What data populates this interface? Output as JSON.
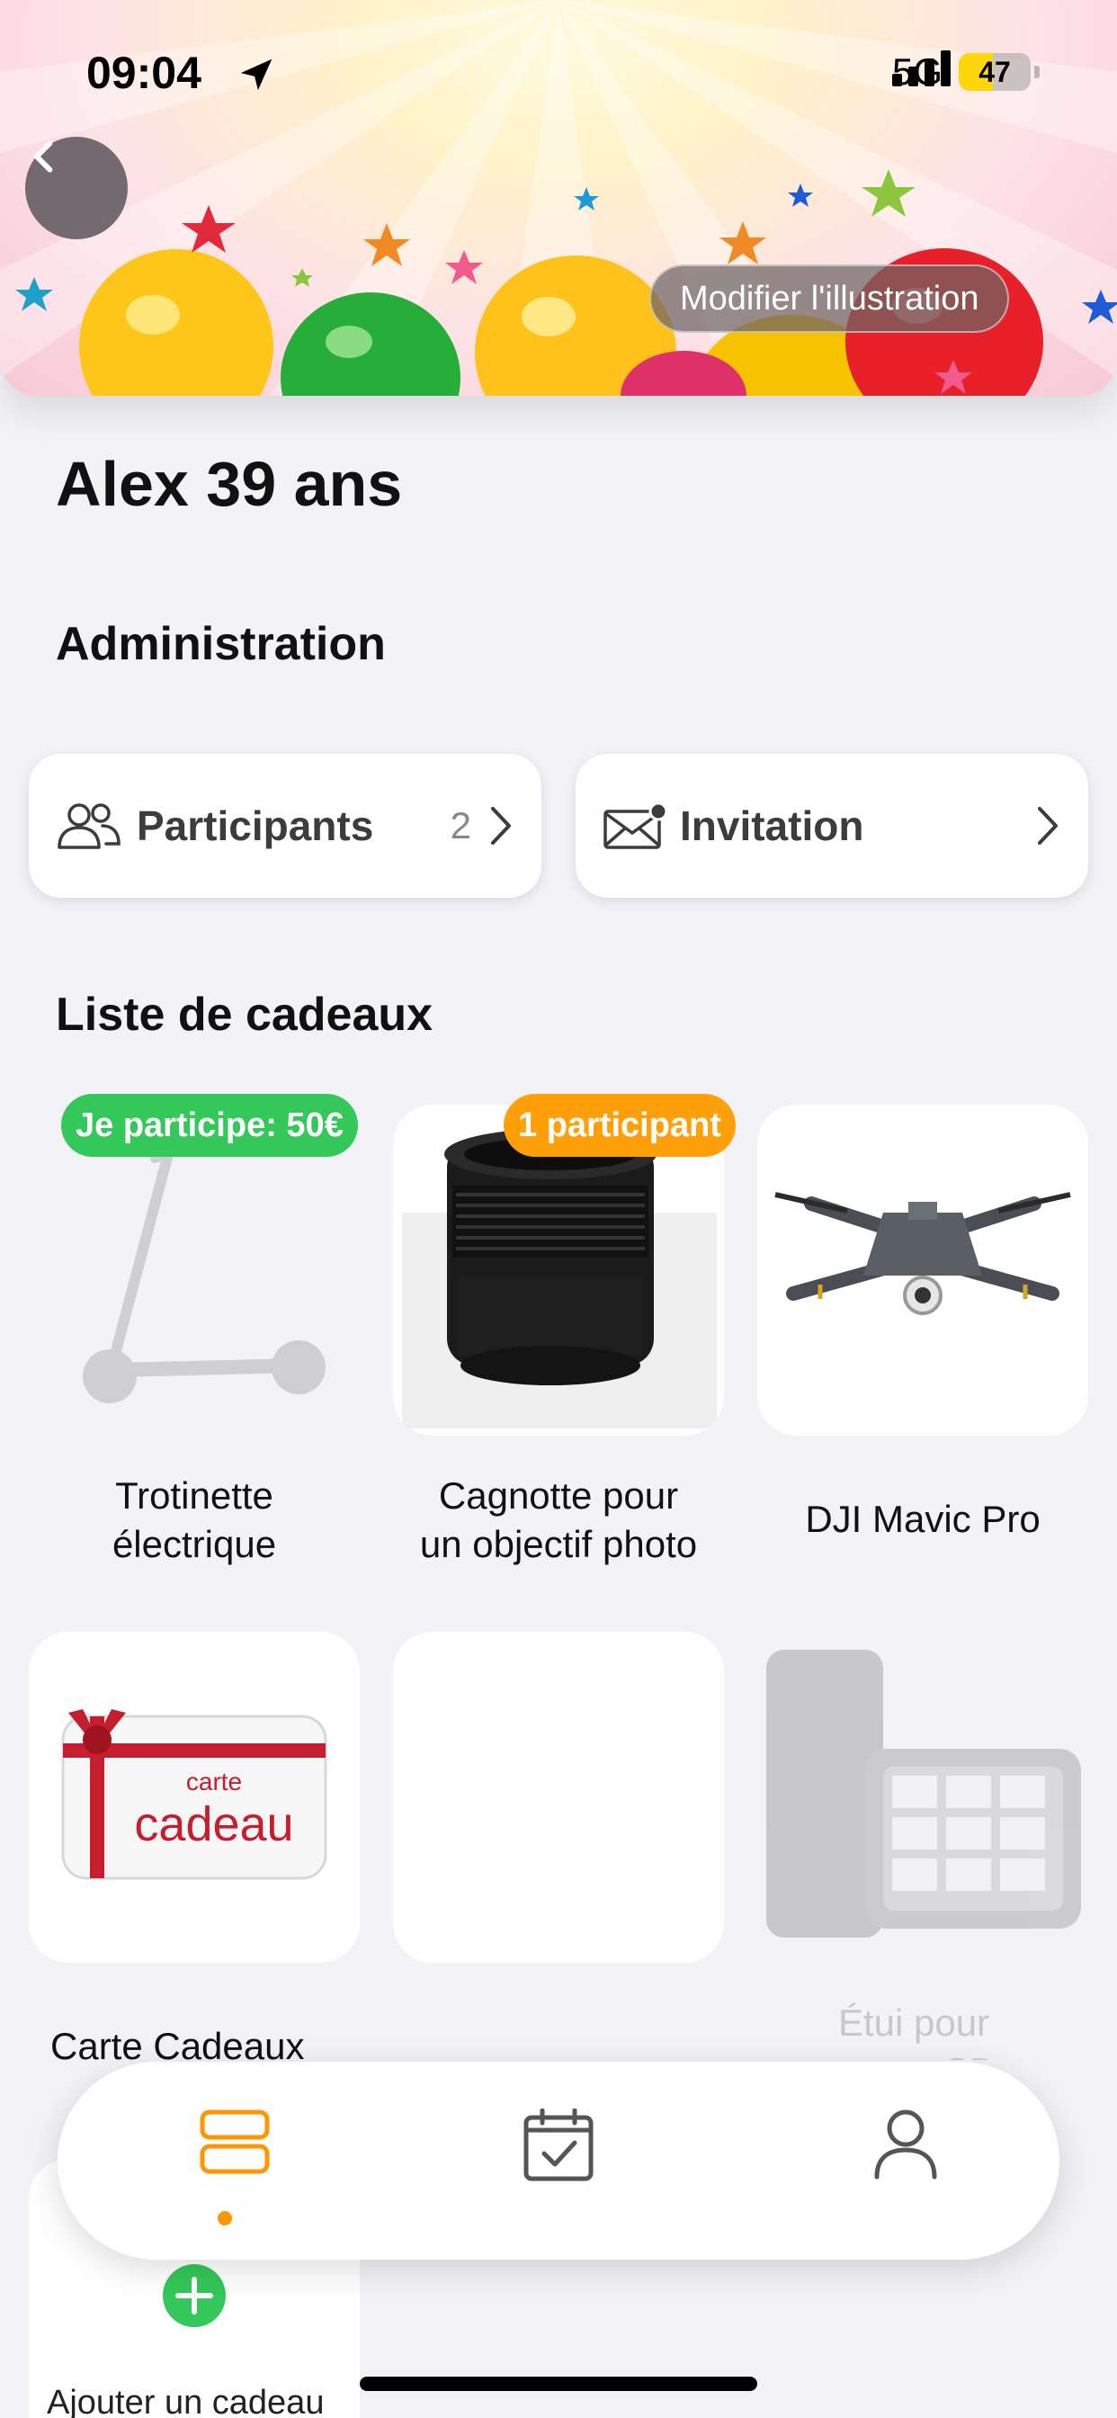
{
  "status_bar": {
    "time": "09:04",
    "network": "5G",
    "battery": "47",
    "battery_level": 0.47
  },
  "header": {
    "edit_illustration_label": "Modifier l'illustration"
  },
  "event": {
    "title": "Alex 39 ans"
  },
  "administration": {
    "title": "Administration",
    "participants": {
      "label": "Participants",
      "count": "2"
    },
    "invitation": {
      "label": "Invitation"
    }
  },
  "gifts": {
    "title": "Liste de cadeaux",
    "items": [
      {
        "name_line1": "Trotinette",
        "name_line2": "électrique",
        "badge": "Je participe: 50€",
        "badge_color": "#34c759",
        "image": "scooter-image",
        "faded": true
      },
      {
        "name_line1": "Cagnotte pour",
        "name_line2": "un objectif photo",
        "badge": "1 participant",
        "badge_color": "#ff9f0a",
        "image": "camera-lens-image",
        "faded": false
      },
      {
        "name_line1": "DJI Mavic Pro",
        "image": "drone-image",
        "faded": false
      },
      {
        "name_line1": "Carte Cadeaux",
        "image": "gift-card-image",
        "image_text_1": "carte",
        "image_text_2": "cadeau",
        "faded": false
      },
      {
        "name_line1": "",
        "image": "empty-image",
        "faded": false
      },
      {
        "name_line1": "Étui pour",
        "name_line2": "cartes SD",
        "image": "sd-case-image",
        "faded": true
      }
    ],
    "add_label": "Ajouter un cadeau"
  },
  "tabbar": {
    "active": "list",
    "accent": "#ff9500",
    "tabs": [
      {
        "name": "list",
        "icon": "list-icon"
      },
      {
        "name": "calendar",
        "icon": "calendar-check-icon"
      },
      {
        "name": "profile",
        "icon": "person-icon"
      }
    ]
  }
}
